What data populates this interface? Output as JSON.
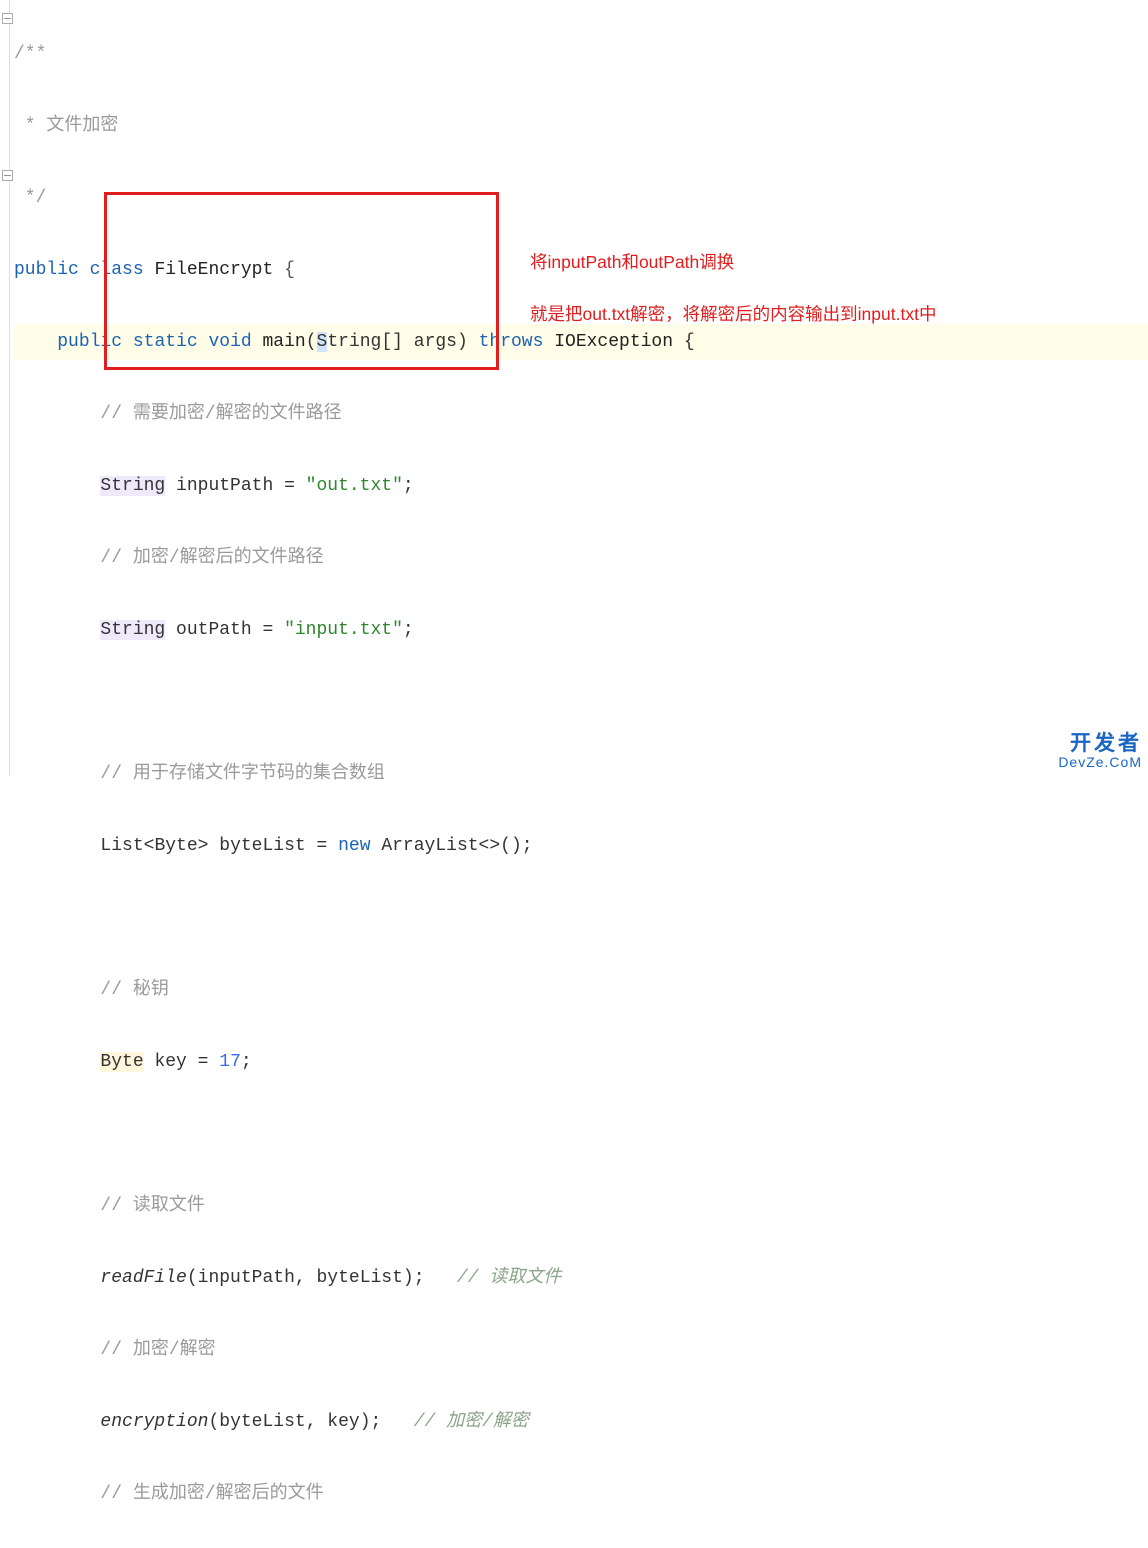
{
  "code": {
    "l1": "/**",
    "l2_pre": " * ",
    "l2_txt": "文件加密",
    "l3": " */",
    "l4_kw1": "public",
    "l4_kw2": "class",
    "l4_name": "FileEncrypt",
    "l5_kw1": "public",
    "l5_kw2": "static",
    "l5_kw3": "void",
    "l5_fn": "main",
    "l5_param_type": "String",
    "l5_param_name": "args",
    "l5_kw4": "throws",
    "l5_ex": "IOException",
    "l6_c": "// 需要加密/解密的文件路径",
    "l7_type": "String",
    "l7_name": "inputPath",
    "l7_val": "\"out.txt\"",
    "l8_c": "// 加密/解密后的文件路径",
    "l9_type": "String",
    "l9_name": "outPath",
    "l9_val": "\"input.txt\"",
    "l10_c": "// 用于存储文件字节码的集合数组",
    "l11_type_a": "List",
    "l11_type_b": "Byte",
    "l11_name": "byteList",
    "l11_kwnew": "new",
    "l11_ctor": "ArrayList",
    "l12_c": "// 秘钥",
    "l13_type": "Byte",
    "l13_name": "key",
    "l13_val": "17",
    "l14_c": "// 读取文件",
    "l15_fn": "readFile",
    "l15_a1": "inputPath",
    "l15_a2": "byteList",
    "l15_ic": "// 读取文件",
    "l16_c": "// 加密/解密",
    "l17_fn": "encryption",
    "l17_a1": "byteList",
    "l17_a2": "key",
    "l17_ic": "// 加密/解密",
    "l18_c": "// 生成加密/解密后的文件"
  },
  "annotations": {
    "a1": "将inputPath和outPath调换",
    "a2": "就是把out.txt解密，将解密后的内容输出到input.txt中"
  },
  "watermark": {
    "line1": "开发者",
    "line2": "DevZe.CoM"
  }
}
